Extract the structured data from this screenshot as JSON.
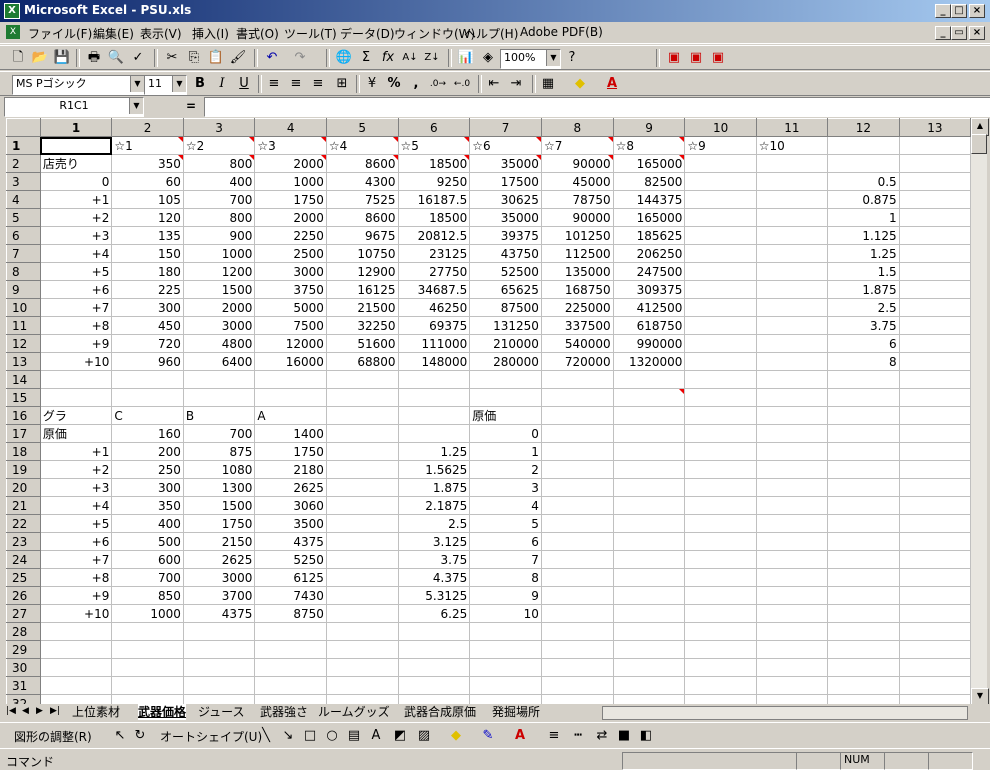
{
  "window": {
    "title": "Microsoft Excel - PSU.xls",
    "app_icon_label": "X",
    "controls": [
      "_",
      "□",
      "×"
    ]
  },
  "menu": {
    "items": [
      "ファイル(F)",
      "編集(E)",
      "表示(V)",
      "挿入(I)",
      "書式(O)",
      "ツール(T)",
      "データ(D)",
      "ウィンドウ(W)",
      "ヘルプ(H)",
      "Adobe PDF(B)"
    ],
    "doc_controls": [
      "_",
      "▭",
      "×"
    ]
  },
  "toolbar": {
    "zoom": "100%",
    "font_name": "MS Pゴシック",
    "font_size": "11",
    "bold": "B",
    "italic": "I",
    "underline": "U",
    "percent": "%",
    "comma": ","
  },
  "formula_bar": {
    "name_box": "R1C1",
    "equals": "=",
    "content": ""
  },
  "grid": {
    "columns": [
      "1",
      "2",
      "3",
      "4",
      "5",
      "6",
      "7",
      "8",
      "9",
      "10",
      "11",
      "12",
      "13"
    ],
    "rows": [
      [
        "",
        "☆1",
        "☆2",
        "☆3",
        "☆4",
        "☆5",
        "☆6",
        "☆7",
        "☆8",
        "☆9",
        "☆10",
        "",
        ""
      ],
      [
        "店売り",
        "350",
        "800",
        "2000",
        "8600",
        "18500",
        "35000",
        "90000",
        "165000",
        "",
        "",
        "",
        ""
      ],
      [
        "0",
        "60",
        "400",
        "1000",
        "4300",
        "9250",
        "17500",
        "45000",
        "82500",
        "",
        "",
        "0.5",
        ""
      ],
      [
        "+1",
        "105",
        "700",
        "1750",
        "7525",
        "16187.5",
        "30625",
        "78750",
        "144375",
        "",
        "",
        "0.875",
        ""
      ],
      [
        "+2",
        "120",
        "800",
        "2000",
        "8600",
        "18500",
        "35000",
        "90000",
        "165000",
        "",
        "",
        "1",
        ""
      ],
      [
        "+3",
        "135",
        "900",
        "2250",
        "9675",
        "20812.5",
        "39375",
        "101250",
        "185625",
        "",
        "",
        "1.125",
        ""
      ],
      [
        "+4",
        "150",
        "1000",
        "2500",
        "10750",
        "23125",
        "43750",
        "112500",
        "206250",
        "",
        "",
        "1.25",
        ""
      ],
      [
        "+5",
        "180",
        "1200",
        "3000",
        "12900",
        "27750",
        "52500",
        "135000",
        "247500",
        "",
        "",
        "1.5",
        ""
      ],
      [
        "+6",
        "225",
        "1500",
        "3750",
        "16125",
        "34687.5",
        "65625",
        "168750",
        "309375",
        "",
        "",
        "1.875",
        ""
      ],
      [
        "+7",
        "300",
        "2000",
        "5000",
        "21500",
        "46250",
        "87500",
        "225000",
        "412500",
        "",
        "",
        "2.5",
        ""
      ],
      [
        "+8",
        "450",
        "3000",
        "7500",
        "32250",
        "69375",
        "131250",
        "337500",
        "618750",
        "",
        "",
        "3.75",
        ""
      ],
      [
        "+9",
        "720",
        "4800",
        "12000",
        "51600",
        "111000",
        "210000",
        "540000",
        "990000",
        "",
        "",
        "6",
        ""
      ],
      [
        "+10",
        "960",
        "6400",
        "16000",
        "68800",
        "148000",
        "280000",
        "720000",
        "1320000",
        "",
        "",
        "8",
        ""
      ],
      [
        "",
        "",
        "",
        "",
        "",
        "",
        "",
        "",
        "",
        "",
        "",
        "",
        ""
      ],
      [
        "",
        "",
        "",
        "",
        "",
        "",
        "",
        "",
        "",
        "",
        "",
        "",
        ""
      ],
      [
        "グラ",
        "C",
        "B",
        "A",
        "",
        "",
        "原価",
        "",
        "",
        "",
        "",
        "",
        ""
      ],
      [
        "原価",
        "160",
        "700",
        "1400",
        "",
        "",
        "0",
        "",
        "",
        "",
        "",
        "",
        ""
      ],
      [
        "+1",
        "200",
        "875",
        "1750",
        "",
        "1.25",
        "1",
        "",
        "",
        "",
        "",
        "",
        ""
      ],
      [
        "+2",
        "250",
        "1080",
        "2180",
        "",
        "1.5625",
        "2",
        "",
        "",
        "",
        "",
        "",
        ""
      ],
      [
        "+3",
        "300",
        "1300",
        "2625",
        "",
        "1.875",
        "3",
        "",
        "",
        "",
        "",
        "",
        ""
      ],
      [
        "+4",
        "350",
        "1500",
        "3060",
        "",
        "2.1875",
        "4",
        "",
        "",
        "",
        "",
        "",
        ""
      ],
      [
        "+5",
        "400",
        "1750",
        "3500",
        "",
        "2.5",
        "5",
        "",
        "",
        "",
        "",
        "",
        ""
      ],
      [
        "+6",
        "500",
        "2150",
        "4375",
        "",
        "3.125",
        "6",
        "",
        "",
        "",
        "",
        "",
        ""
      ],
      [
        "+7",
        "600",
        "2625",
        "5250",
        "",
        "3.75",
        "7",
        "",
        "",
        "",
        "",
        "",
        ""
      ],
      [
        "+8",
        "700",
        "3000",
        "6125",
        "",
        "4.375",
        "8",
        "",
        "",
        "",
        "",
        "",
        ""
      ],
      [
        "+9",
        "850",
        "3700",
        "7430",
        "",
        "5.3125",
        "9",
        "",
        "",
        "",
        "",
        "",
        ""
      ],
      [
        "+10",
        "1000",
        "4375",
        "8750",
        "",
        "6.25",
        "10",
        "",
        "",
        "",
        "",
        "",
        ""
      ],
      [
        "",
        "",
        "",
        "",
        "",
        "",
        "",
        "",
        "",
        "",
        "",
        "",
        ""
      ],
      [
        "",
        "",
        "",
        "",
        "",
        "",
        "",
        "",
        "",
        "",
        "",
        "",
        ""
      ],
      [
        "",
        "",
        "",
        "",
        "",
        "",
        "",
        "",
        "",
        "",
        "",
        "",
        ""
      ],
      [
        "",
        "",
        "",
        "",
        "",
        "",
        "",
        "",
        "",
        "",
        "",
        "",
        ""
      ],
      [
        "",
        "",
        "",
        "",
        "",
        "",
        "",
        "",
        "",
        "",
        "",
        "",
        ""
      ]
    ],
    "row_labels": [
      "1",
      "2",
      "3",
      "4",
      "5",
      "6",
      "7",
      "8",
      "9",
      "10",
      "11",
      "12",
      "13",
      "14",
      "15",
      "16",
      "17",
      "18",
      "19",
      "20",
      "21",
      "22",
      "23",
      "24",
      "25",
      "26",
      "27",
      "28",
      "29",
      "30",
      "31",
      "32"
    ]
  },
  "sheet_tabs": {
    "tabs": [
      "上位素材",
      "武器価格",
      "ジュース",
      "武器強さ",
      "ルームグッズ",
      "武器合成原価",
      "発掘場所"
    ],
    "active": "武器価格"
  },
  "drawing_toolbar": {
    "draw_menu": "図形の調整(R)",
    "autoshape_menu": "オートシェイプ(U)"
  },
  "status_bar": {
    "mode": "コマンド",
    "num": "NUM"
  }
}
